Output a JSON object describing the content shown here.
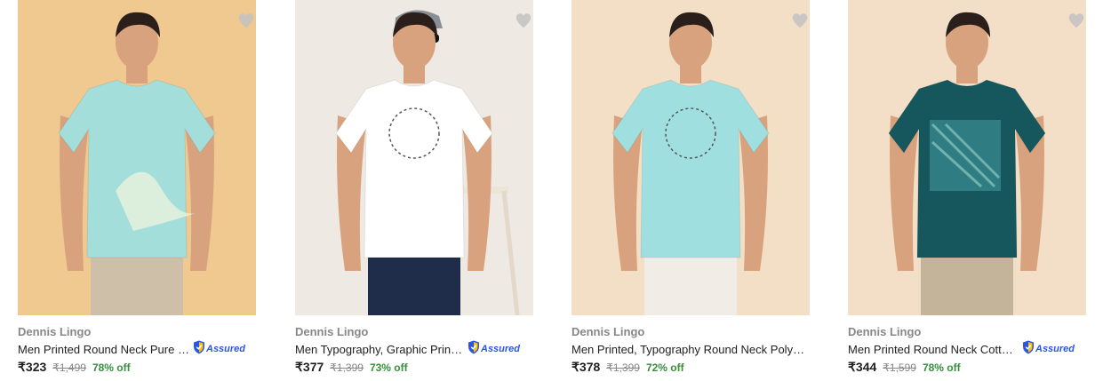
{
  "products": [
    {
      "brand": "Dennis Lingo",
      "title": "Men Printed Round Neck Pure Cotton Light Blue T-Shirt",
      "price": "₹323",
      "mrp": "₹1,499",
      "discount": "78% off",
      "assured": true,
      "assured_label": "Assured",
      "background": "#efc98f",
      "shirt_color": "#a3dedb"
    },
    {
      "brand": "Dennis Lingo",
      "title": "Men Typography, Graphic Print Round Neck Cotton White T-Shirt",
      "price": "₹377",
      "mrp": "₹1,399",
      "discount": "73% off",
      "assured": true,
      "assured_label": "Assured",
      "background": "#efe9e3",
      "shirt_color": "#ffffff"
    },
    {
      "brand": "Dennis Lingo",
      "title": "Men Printed, Typography Round Neck Polycotton Light Blue T-Shirt",
      "price": "₹378",
      "mrp": "₹1,399",
      "discount": "72% off",
      "assured": false,
      "assured_label": "",
      "background": "#f3dfc5",
      "shirt_color": "#9fdfe0"
    },
    {
      "brand": "Dennis Lingo",
      "title": "Men Printed Round Neck Cotton Dark Green T-Shirt",
      "price": "₹344",
      "mrp": "₹1,599",
      "discount": "78% off",
      "assured": true,
      "assured_label": "Assured",
      "background": "#f3dfc8",
      "shirt_color": "#15575c"
    }
  ],
  "icons": {
    "wishlist": "heart-icon",
    "assured": "shield-icon"
  },
  "colors": {
    "discount": "#388e3c",
    "muted": "#878787",
    "assured": "#2a55e5"
  }
}
